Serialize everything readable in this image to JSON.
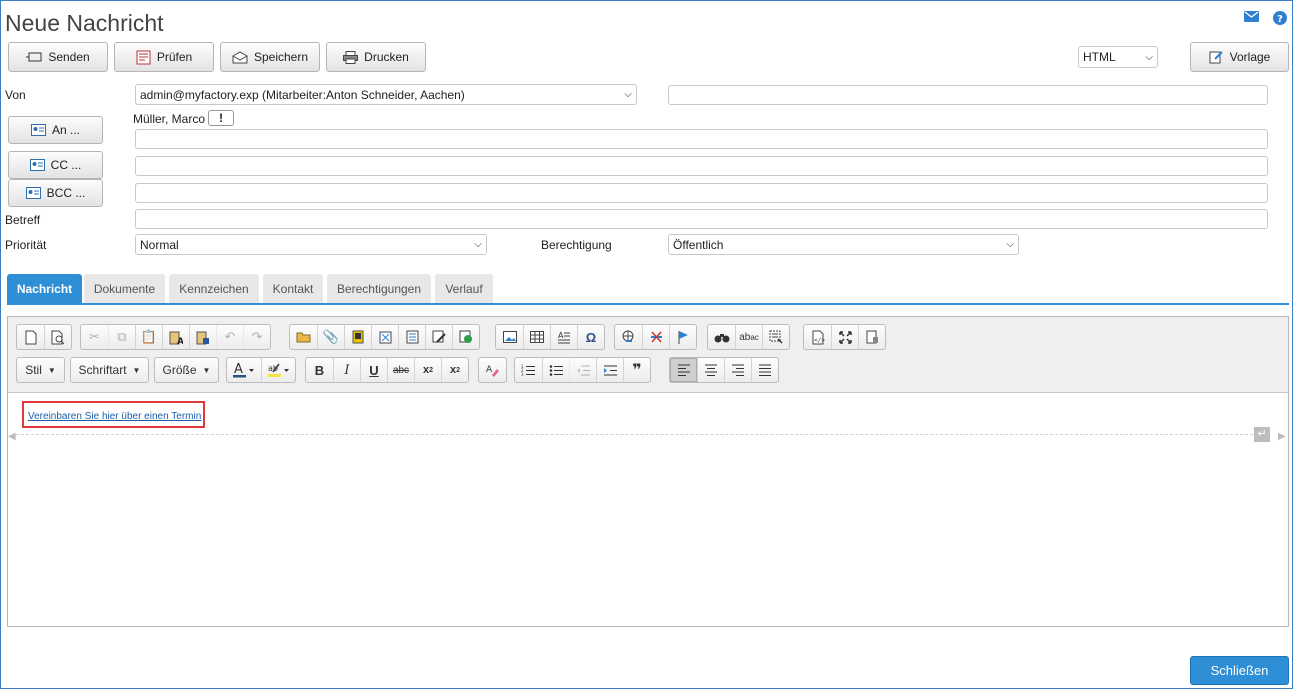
{
  "window": {
    "title": "Neue Nachricht"
  },
  "toolbar": {
    "send": "Senden",
    "check": "Prüfen",
    "save": "Speichern",
    "print": "Drucken",
    "format_value": "HTML",
    "template": "Vorlage"
  },
  "form": {
    "from_label": "Von",
    "from_value": "admin@myfactory.exp (Mitarbeiter:Anton Schneider, Aachen)",
    "to_button": "An ...",
    "to_recipient": "Müller, Marco",
    "to_recipient_flag": "!",
    "cc_button": "CC ...",
    "bcc_button": "BCC ...",
    "subject_label": "Betreff",
    "priority_label": "Priorität",
    "priority_value": "Normal",
    "permission_label": "Berechtigung",
    "permission_value": "Öffentlich"
  },
  "tabs": [
    {
      "label": "Nachricht"
    },
    {
      "label": "Dokumente"
    },
    {
      "label": "Kennzeichen"
    },
    {
      "label": "Kontakt"
    },
    {
      "label": "Berechtigungen"
    },
    {
      "label": "Verlauf"
    }
  ],
  "editor": {
    "style_combo": "Stil",
    "font_combo": "Schriftart",
    "size_combo": "Größe",
    "body_link": "Vereinbaren Sie hier über einen Termin"
  },
  "footer": {
    "close": "Schließen"
  },
  "colors": {
    "accent": "#2e8fd6",
    "highlight_border": "#e0393a",
    "link": "#1d5fa8"
  }
}
